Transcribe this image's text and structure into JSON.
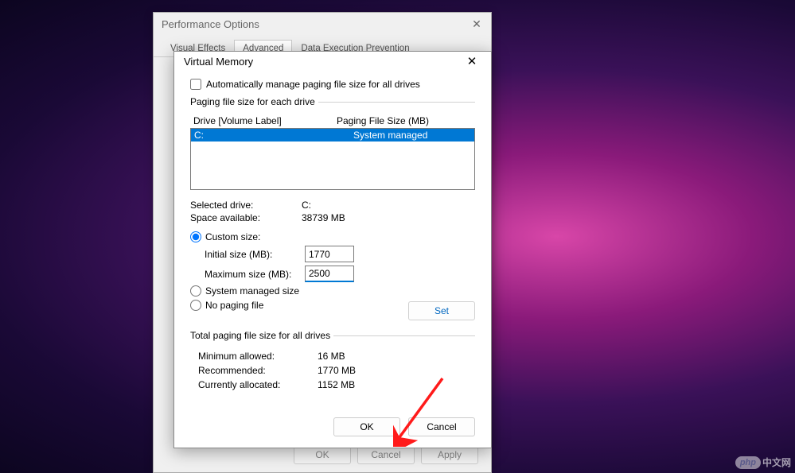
{
  "perf_window": {
    "title": "Performance Options",
    "tabs": [
      "Visual Effects",
      "Advanced",
      "Data Execution Prevention"
    ],
    "active_tab_index": 1,
    "buttons": {
      "ok": "OK",
      "cancel": "Cancel",
      "apply": "Apply"
    }
  },
  "vm_window": {
    "title": "Virtual Memory",
    "auto_manage_label": "Automatically manage paging file size for all drives",
    "auto_manage_checked": false,
    "group1_legend": "Paging file size for each drive",
    "drive_header_col1": "Drive  [Volume Label]",
    "drive_header_col2": "Paging File Size (MB)",
    "drives": [
      {
        "label": "C:",
        "size": "System managed",
        "selected": true
      }
    ],
    "selected_drive_label": "Selected drive:",
    "selected_drive_value": "C:",
    "space_available_label": "Space available:",
    "space_available_value": "38739 MB",
    "size_option": "custom",
    "custom_size_label": "Custom size:",
    "initial_size_label": "Initial size (MB):",
    "initial_size_value": "1770",
    "maximum_size_label": "Maximum size (MB):",
    "maximum_size_value": "2500",
    "system_managed_label": "System managed size",
    "no_paging_label": "No paging file",
    "set_button": "Set",
    "group2_legend": "Total paging file size for all drives",
    "min_allowed_label": "Minimum allowed:",
    "min_allowed_value": "16 MB",
    "recommended_label": "Recommended:",
    "recommended_value": "1770 MB",
    "currently_allocated_label": "Currently allocated:",
    "currently_allocated_value": "1152 MB",
    "ok_button": "OK",
    "cancel_button": "Cancel"
  },
  "watermark": {
    "badge": "php",
    "text": "中文网"
  },
  "colors": {
    "selection": "#0078d4",
    "arrow": "#ff1a1a"
  }
}
